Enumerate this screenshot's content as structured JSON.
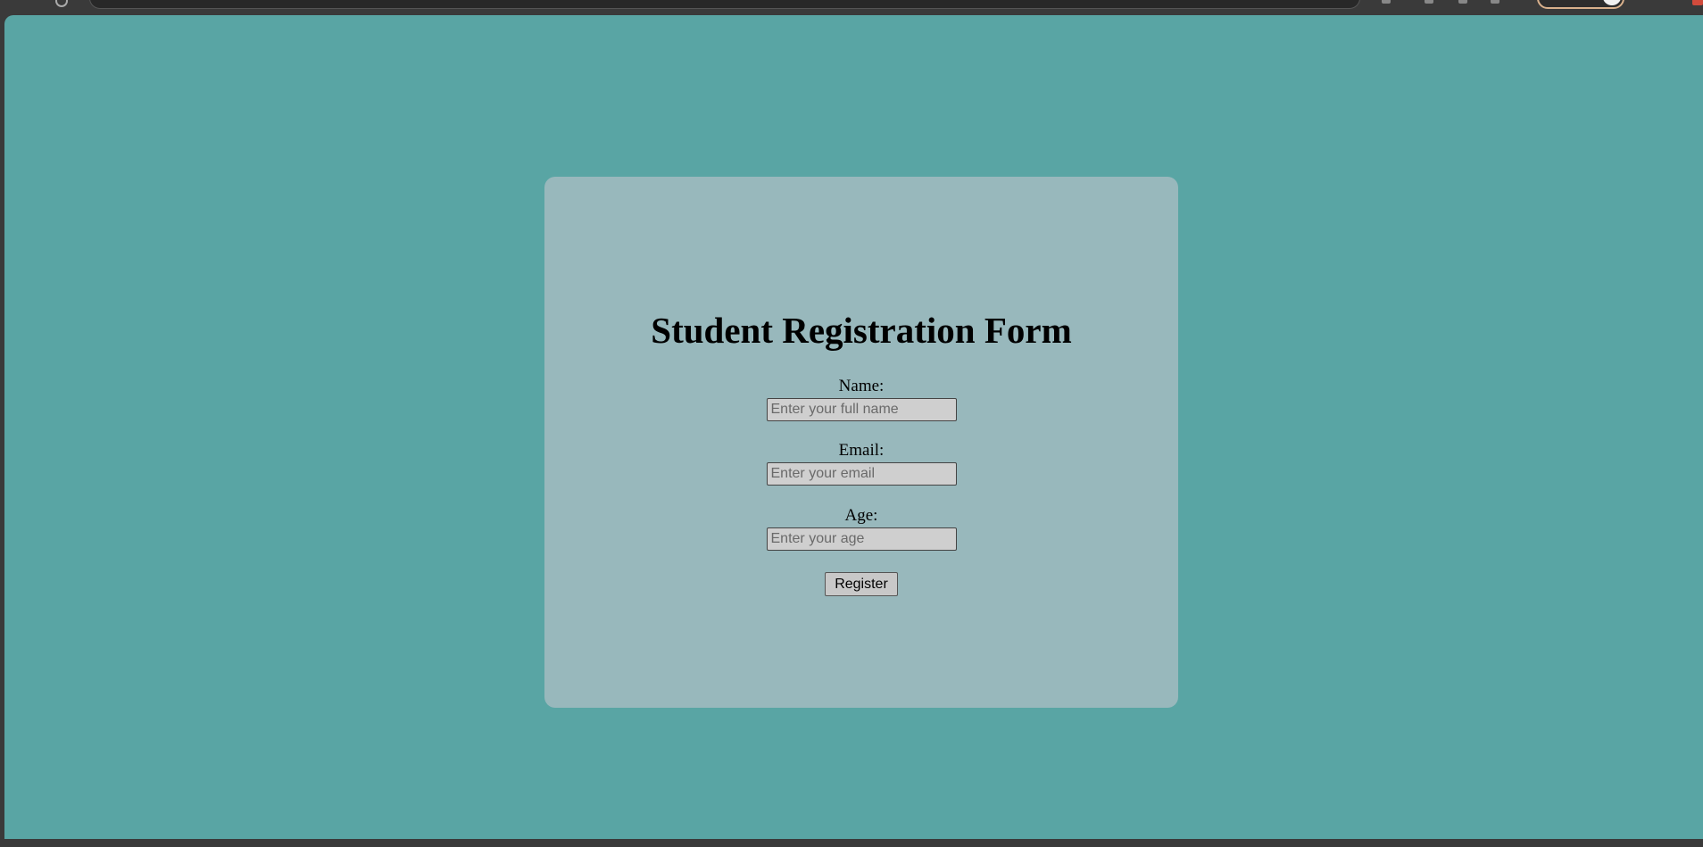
{
  "form": {
    "title": "Student Registration Form",
    "fields": [
      {
        "label": "Name:",
        "placeholder": "Enter your full name",
        "value": ""
      },
      {
        "label": "Email:",
        "placeholder": "Enter your email",
        "value": ""
      },
      {
        "label": "Age:",
        "placeholder": "Enter your age",
        "value": ""
      }
    ],
    "submit_label": "Register"
  },
  "colors": {
    "page_background": "#59a5a4",
    "card_background": "#98b8bc",
    "input_background": "#cfcfcf",
    "button_background": "#c8c8c8",
    "chrome_background": "#3a3a3a"
  }
}
